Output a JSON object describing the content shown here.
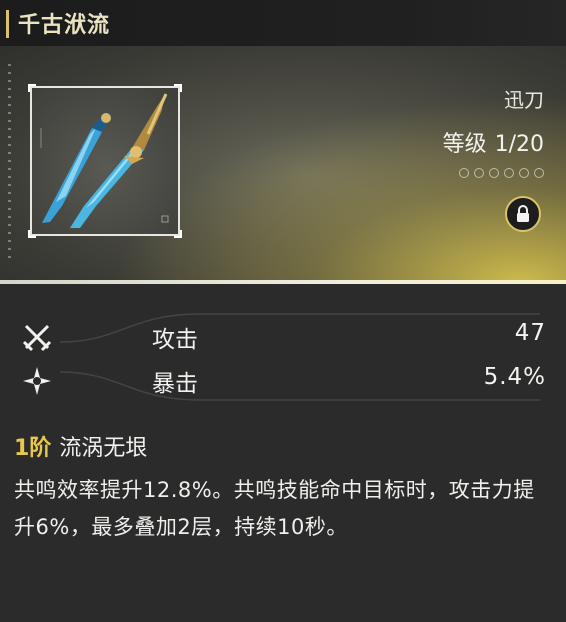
{
  "weapon": {
    "name": "千古洑流",
    "type": "迅刀",
    "level_label": "等级",
    "level_value": "1/20",
    "rank_slots": 6,
    "locked": true,
    "icon": "dual-blade-icon"
  },
  "stats": [
    {
      "icon": "crossed-swords-icon",
      "label": "攻击",
      "value": "47"
    },
    {
      "icon": "star-burst-icon",
      "label": "暴击",
      "value": "5.4%"
    }
  ],
  "passive": {
    "rank": "1阶",
    "name": "流涡无垠",
    "description": "共鸣效率提升12.8%。共鸣技能命中目标时，攻击力提升6%，最多叠加2层，持续10秒。"
  },
  "colors": {
    "accent_gold": "#e6c84a",
    "background": "#2b2b2b",
    "hero_glow": "#e6d050"
  }
}
